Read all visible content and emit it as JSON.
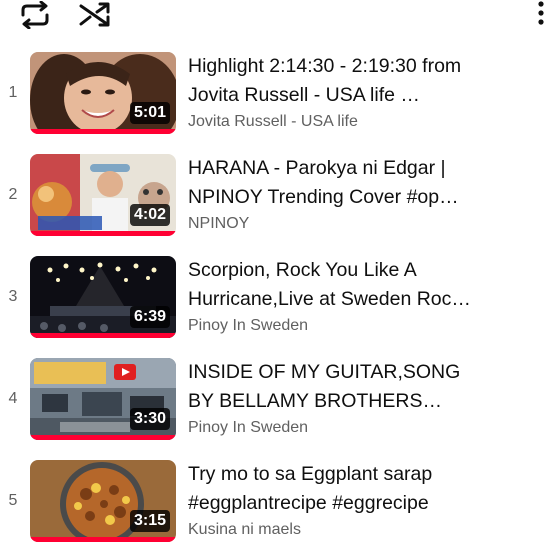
{
  "toolbar": {
    "loop_icon": "repeat-icon",
    "shuffle_icon": "shuffle-icon",
    "more_icon": "more-vertical-icon"
  },
  "colors": {
    "progress": "#ff0033",
    "text_primary": "#0f0f0f",
    "text_secondary": "#606060"
  },
  "playlist": [
    {
      "index": "1",
      "title": "Highlight 2:14:30 - 2:19:30 from Jovita Russell - USA life …",
      "channel": "Jovita Russell - USA life",
      "duration": "5:01",
      "watched_fraction": 1.0
    },
    {
      "index": "2",
      "title": "HARANA - Parokya ni Edgar | NPINOY Trending Cover #op…",
      "channel": "NPINOY",
      "duration": "4:02",
      "watched_fraction": 1.0
    },
    {
      "index": "3",
      "title": "Scorpion, Rock You Like A Hurricane,Live at Sweden Roc…",
      "channel": "Pinoy In Sweden",
      "duration": "6:39",
      "watched_fraction": 1.0
    },
    {
      "index": "4",
      "title": "INSIDE OF MY GUITAR,SONG BY BELLAMY BROTHERS…",
      "channel": "Pinoy In Sweden",
      "duration": "3:30",
      "watched_fraction": 1.0
    },
    {
      "index": "5",
      "title": "Try mo to sa Eggplant sarap #eggplantrecipe #eggrecipe",
      "channel": "Kusina ni maels",
      "duration": "3:15",
      "watched_fraction": 1.0
    }
  ]
}
